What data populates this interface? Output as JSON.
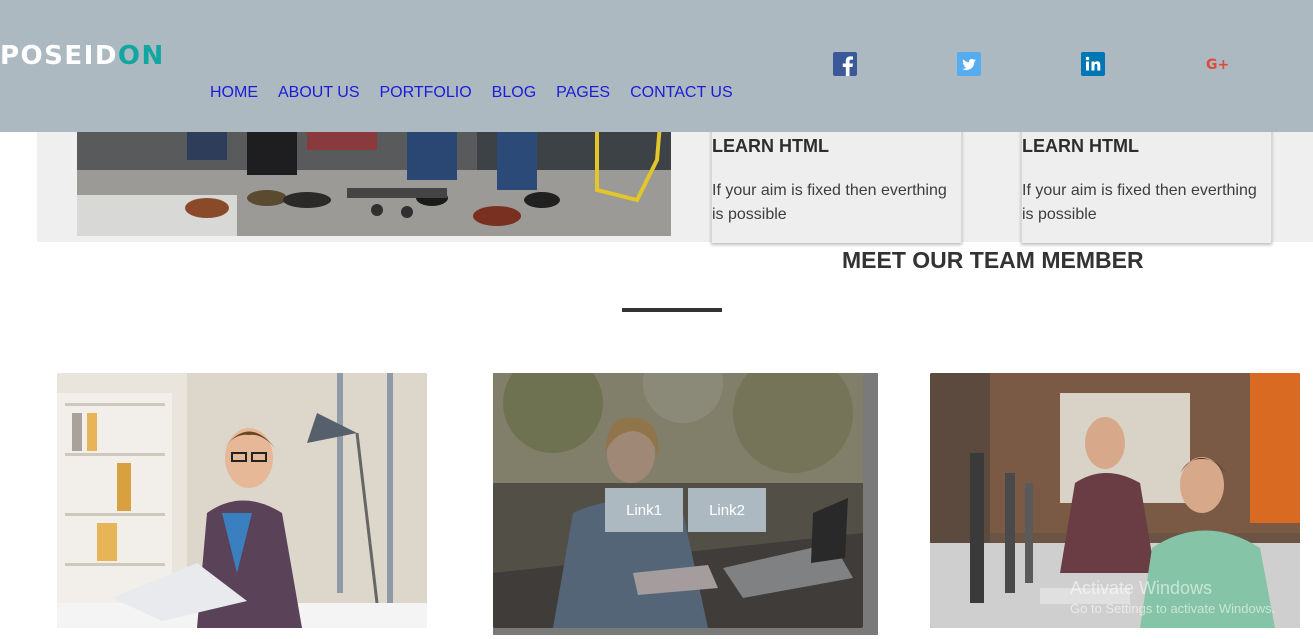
{
  "brand": {
    "logo_main": "POSEID",
    "logo_accent": "ON"
  },
  "nav": [
    {
      "label": "HOME"
    },
    {
      "label": "ABOUT US"
    },
    {
      "label": "PORTFOLIO"
    },
    {
      "label": "BLOG"
    },
    {
      "label": "PAGES"
    },
    {
      "label": "CONTACT US"
    }
  ],
  "social": [
    {
      "icon": "facebook-icon",
      "color": "#3b5998"
    },
    {
      "icon": "twitter-icon",
      "color": "#55acee"
    },
    {
      "icon": "linkedin-icon",
      "color": "#0077b5"
    },
    {
      "icon": "google-plus-icon",
      "color": "#dd4b39",
      "text": "G+"
    }
  ],
  "cards": [
    {
      "title": "LEARN HTML",
      "text": "If your aim is fixed then everthing is possible"
    },
    {
      "title": "LEARN HTML",
      "text": "If your aim is fixed then everthing is possible"
    }
  ],
  "team": {
    "title": "MEET OUR TEAM MEMBER",
    "links": [
      {
        "label": "Link1"
      },
      {
        "label": "Link2"
      }
    ]
  },
  "watermark": {
    "title": "Activate Windows",
    "subtitle": "Go to Settings to activate Windows."
  },
  "colors": {
    "header_bg": "#adb9c1",
    "nav_link": "#1b1bd8",
    "logo_accent": "#11a7a1",
    "button_bg": "#adb9c1"
  }
}
